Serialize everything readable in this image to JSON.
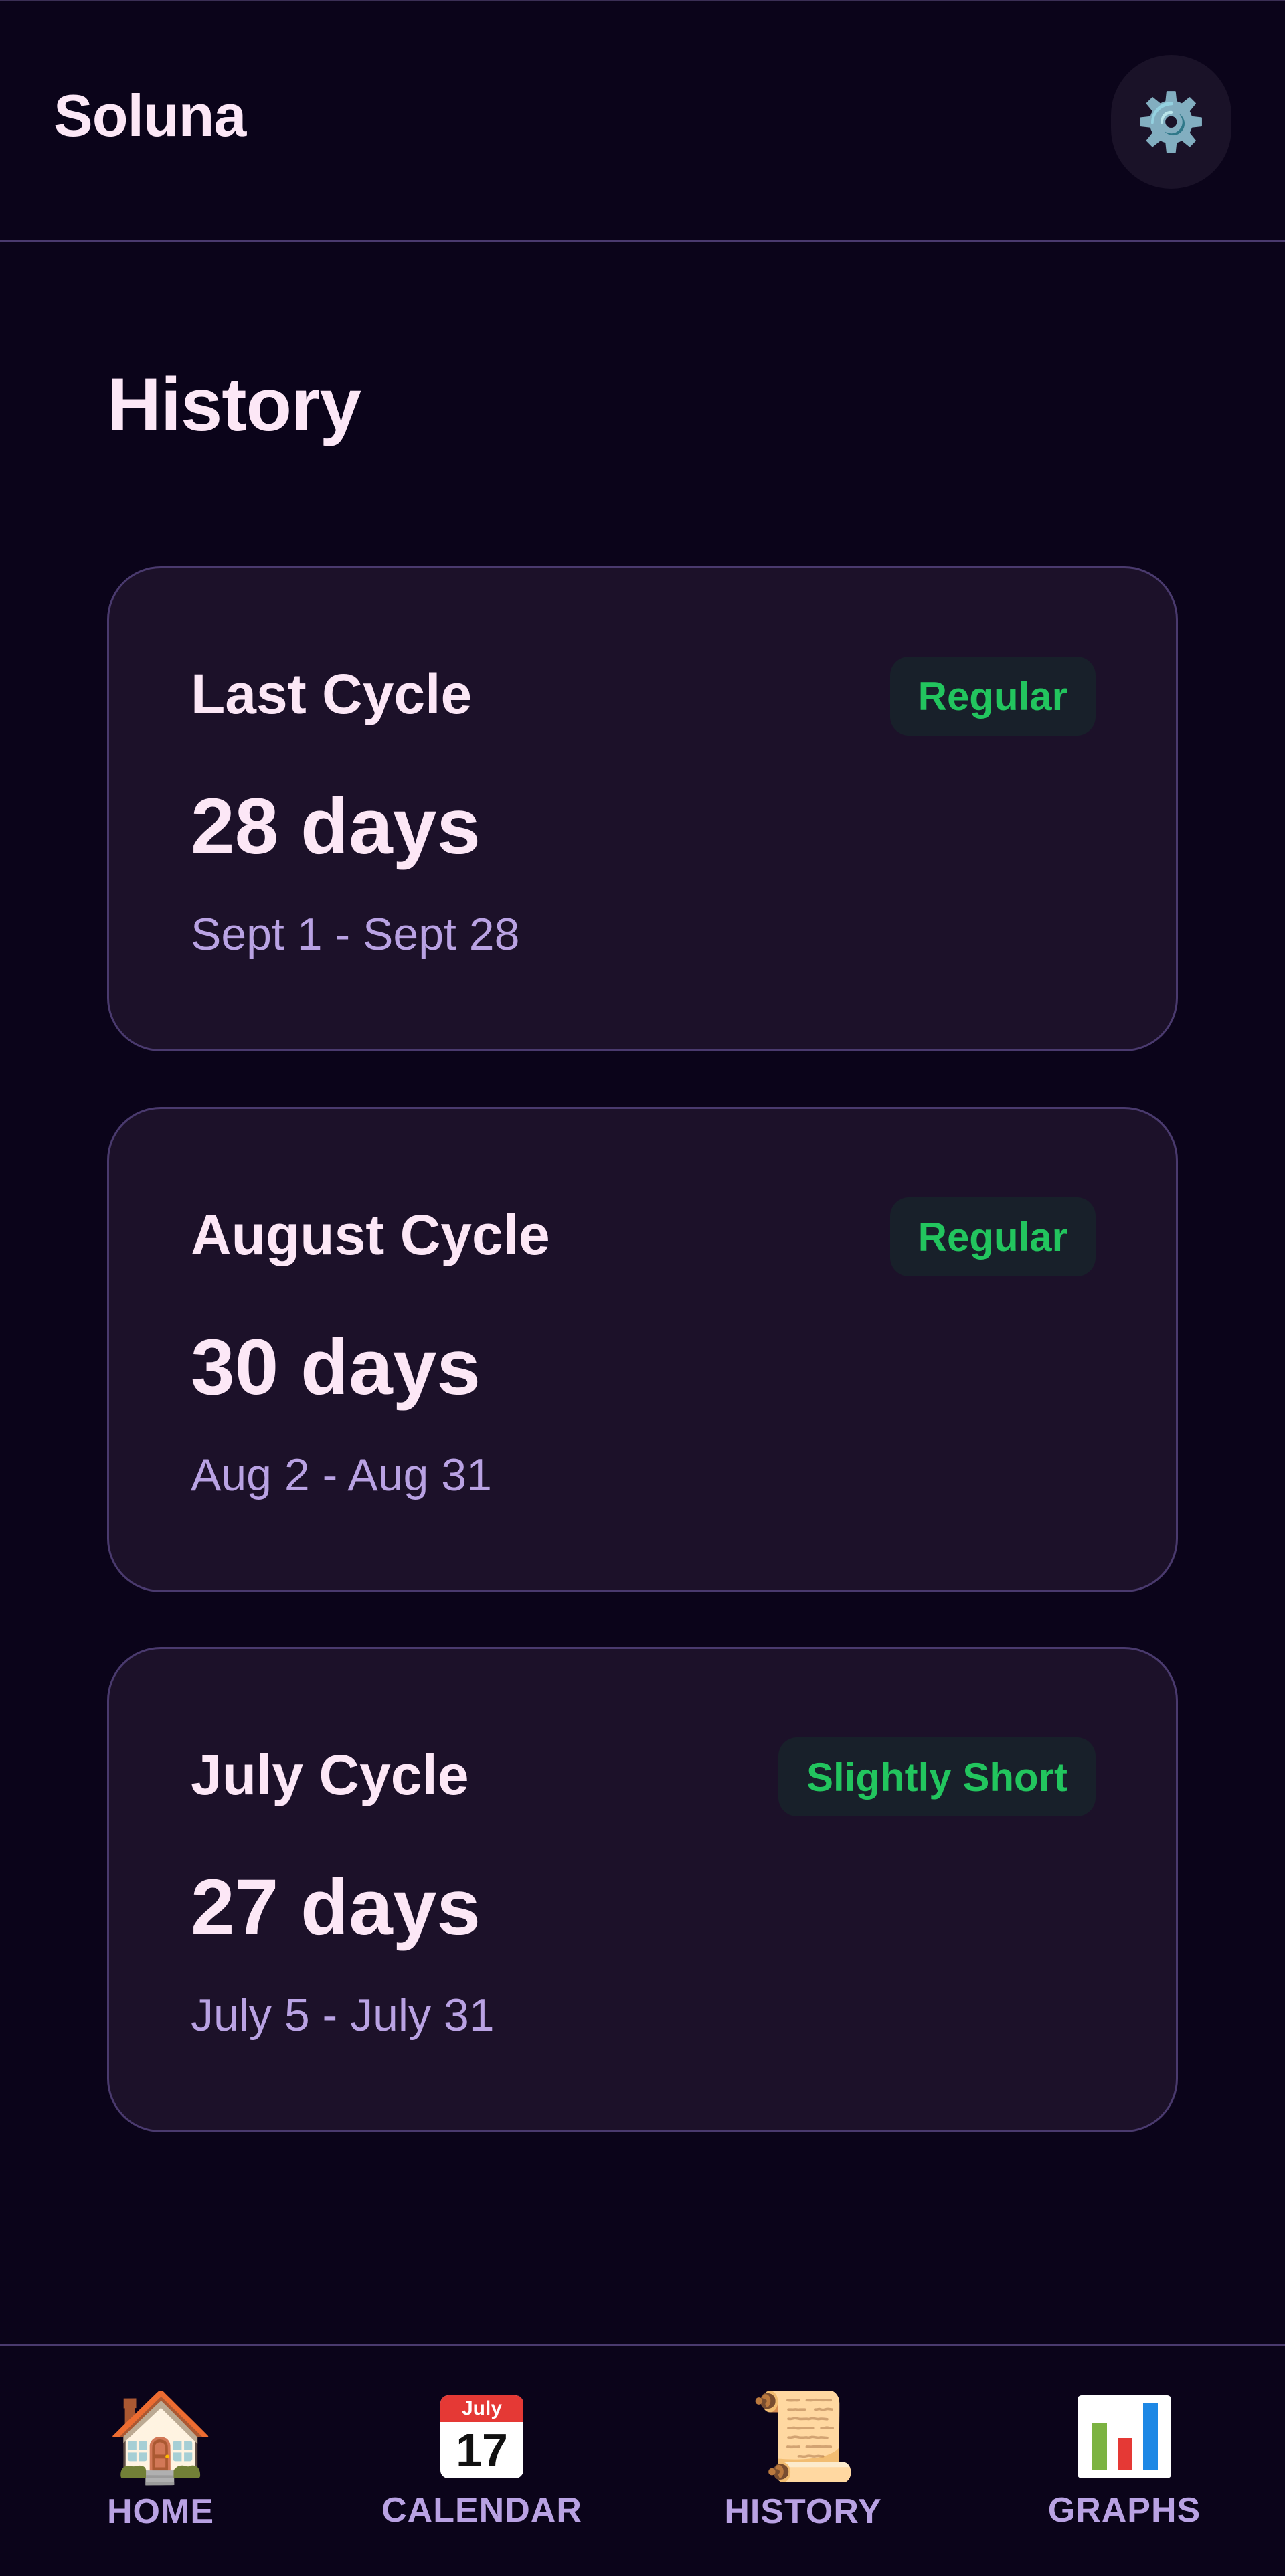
{
  "header": {
    "app_title": "Soluna",
    "settings_icon": "gear-icon"
  },
  "page": {
    "title": "History"
  },
  "cycles": [
    {
      "title": "Last Cycle",
      "badge": "Regular",
      "days": "28 days",
      "range": "Sept 1 - Sept 28"
    },
    {
      "title": "August Cycle",
      "badge": "Regular",
      "days": "30 days",
      "range": "Aug 2 - Aug 31"
    },
    {
      "title": "July Cycle",
      "badge": "Slightly Short",
      "days": "27 days",
      "range": "July 5 - July 31"
    }
  ],
  "nav": {
    "items": [
      {
        "label": "HOME",
        "icon": "house-icon"
      },
      {
        "label": "CALENDAR",
        "icon": "calendar-icon",
        "icon_month": "July",
        "icon_day": "17"
      },
      {
        "label": "HISTORY",
        "icon": "scroll-icon"
      },
      {
        "label": "GRAPHS",
        "icon": "bar-chart-icon"
      }
    ]
  },
  "colors": {
    "background": "#0b041a",
    "card": "#1c1129",
    "border": "#4a3a6e",
    "badge_text": "#22c55e",
    "muted_text": "#b9a2e3"
  }
}
